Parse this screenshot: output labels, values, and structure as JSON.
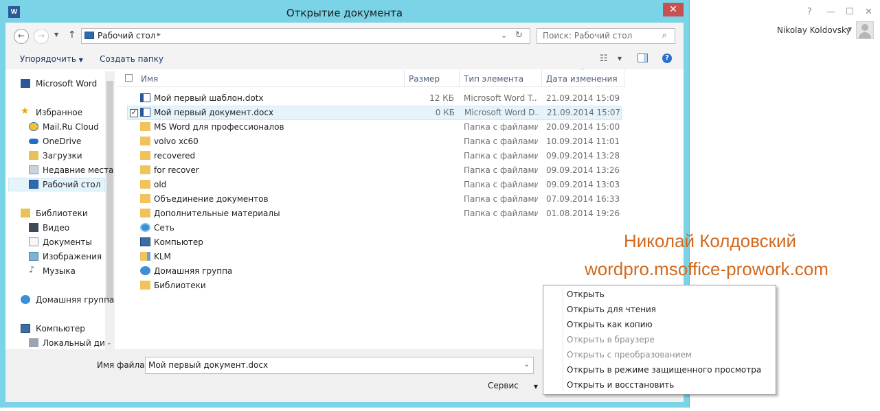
{
  "background_window": {
    "controls": [
      "?",
      "—",
      "☐",
      "✕"
    ],
    "user_name": "Nikolay Koldovsky"
  },
  "dialog": {
    "title": "Открытие документа",
    "address_path": "Рабочий стол",
    "search_placeholder": "Поиск: Рабочий стол",
    "toolbar": {
      "organize": "Упорядочить",
      "new_folder": "Создать папку"
    },
    "sidebar": [
      {
        "label": "Microsoft Word",
        "icon": "word-icon"
      },
      {
        "label": "Избранное",
        "icon": "star-icon"
      },
      {
        "label": "Mail.Ru Cloud",
        "icon": "cloud-icon"
      },
      {
        "label": "OneDrive",
        "icon": "onedrive-icon"
      },
      {
        "label": "Загрузки",
        "icon": "downloads-icon"
      },
      {
        "label": "Недавние места",
        "icon": "recent-places-icon"
      },
      {
        "label": "Рабочий стол",
        "icon": "desktop-icon"
      },
      {
        "label": "Библиотеки",
        "icon": "libraries-icon"
      },
      {
        "label": "Видео",
        "icon": "video-icon"
      },
      {
        "label": "Документы",
        "icon": "documents-icon"
      },
      {
        "label": "Изображения",
        "icon": "images-icon"
      },
      {
        "label": "Музыка",
        "icon": "music-icon"
      },
      {
        "label": "Домашняя группа",
        "icon": "homegroup-icon"
      },
      {
        "label": "Компьютер",
        "icon": "computer-icon"
      },
      {
        "label": "Локальный диск",
        "icon": "drive-icon"
      }
    ],
    "columns": {
      "name": "Имя",
      "size": "Размер",
      "type": "Тип элемента",
      "date": "Дата изменения"
    },
    "files": [
      {
        "name": "Мой первый шаблон.dotx",
        "size": "12 КБ",
        "type": "Microsoft Word T...",
        "date": "21.09.2014 15:09",
        "icon": "word-doc-icon"
      },
      {
        "name": "Мой первый документ.docx",
        "size": "0 КБ",
        "type": "Microsoft Word D...",
        "date": "21.09.2014 15:07",
        "icon": "word-doc-icon"
      },
      {
        "name": "MS Word для профессионалов",
        "size": "",
        "type": "Папка с файлами",
        "date": "20.09.2014 15:00",
        "icon": "folder-icon"
      },
      {
        "name": "volvo xc60",
        "size": "",
        "type": "Папка с файлами",
        "date": "10.09.2014 11:01",
        "icon": "folder-icon"
      },
      {
        "name": "recovered",
        "size": "",
        "type": "Папка с файлами",
        "date": "09.09.2014 13:28",
        "icon": "folder-icon"
      },
      {
        "name": "for recover",
        "size": "",
        "type": "Папка с файлами",
        "date": "09.09.2014 13:26",
        "icon": "folder-icon"
      },
      {
        "name": "old",
        "size": "",
        "type": "Папка с файлами",
        "date": "09.09.2014 13:03",
        "icon": "folder-icon"
      },
      {
        "name": "Объединение документов",
        "size": "",
        "type": "Папка с файлами",
        "date": "07.09.2014 16:33",
        "icon": "folder-icon"
      },
      {
        "name": "Дополнительные материалы",
        "size": "",
        "type": "Папка с файлами",
        "date": "01.08.2014 19:26",
        "icon": "folder-icon"
      },
      {
        "name": "Сеть",
        "size": "",
        "type": "",
        "date": "",
        "icon": "network-icon"
      },
      {
        "name": "Компьютер",
        "size": "",
        "type": "",
        "date": "",
        "icon": "computer-icon"
      },
      {
        "name": "KLM",
        "size": "",
        "type": "",
        "date": "",
        "icon": "user-folder-icon"
      },
      {
        "name": "Домашняя группа",
        "size": "",
        "type": "",
        "date": "",
        "icon": "homegroup-icon"
      },
      {
        "name": "Библиотеки",
        "size": "",
        "type": "",
        "date": "",
        "icon": "libraries-icon"
      }
    ],
    "filename_label": "Имя файла:",
    "filename_value": "Мой первый документ.docx",
    "service_label": "Сервис",
    "open_menu": [
      {
        "label": "Открыть",
        "enabled": true
      },
      {
        "label": "Открыть для чтения",
        "enabled": true
      },
      {
        "label": "Открыть как копию",
        "enabled": true
      },
      {
        "label": "Открыть в браузере",
        "enabled": false
      },
      {
        "label": "Открыть с преобразованием",
        "enabled": false
      },
      {
        "label": "Открыть в режиме защищенного просмотра",
        "enabled": true
      },
      {
        "label": "Открыть и восстановить",
        "enabled": true
      }
    ]
  },
  "watermark": {
    "line1": "Николай Колдовский",
    "line2": "wordpro.msoffice-prowork.com"
  },
  "colors": {
    "frame": "#7ad3e6",
    "close": "#c75050",
    "selection": "#e5f3fb",
    "watermark": "#d2691e"
  }
}
